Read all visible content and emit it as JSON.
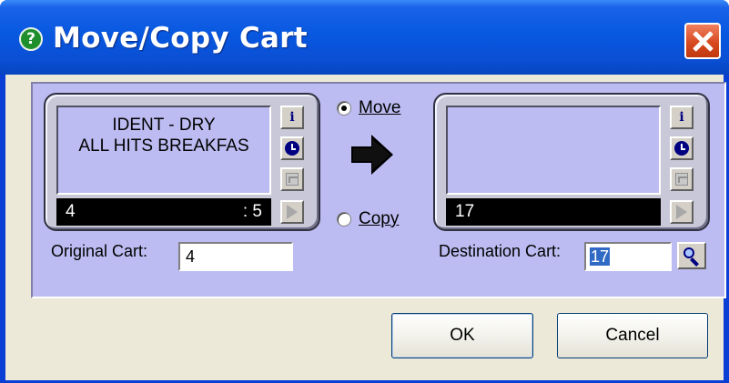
{
  "window": {
    "title": "Move/Copy Cart",
    "help_icon_glyph": "?",
    "icons": {
      "help": "help-icon",
      "close": "close-icon"
    },
    "colors": {
      "titlebar": "#0858e0",
      "panel": "#bcbcf2",
      "close_button": "#d84a20"
    }
  },
  "source_cart": {
    "line1": "IDENT - DRY",
    "line2": "ALL HITS BREAKFAS",
    "number": "4",
    "length": ": 5"
  },
  "destination_cart": {
    "line1": "",
    "line2": "",
    "number": "17",
    "length": ""
  },
  "side_buttons": [
    {
      "icon": "info-icon",
      "glyph": "i"
    },
    {
      "icon": "clock-icon"
    },
    {
      "icon": "waveform-icon"
    },
    {
      "icon": "play-icon"
    }
  ],
  "mode": {
    "move_label": "Move",
    "copy_label": "Copy",
    "selected": "Move"
  },
  "fields": {
    "original_label": "Original Cart:",
    "original_value": "4",
    "destination_label": "Destination Cart:",
    "destination_value": "17"
  },
  "buttons": {
    "ok": "OK",
    "cancel": "Cancel"
  }
}
